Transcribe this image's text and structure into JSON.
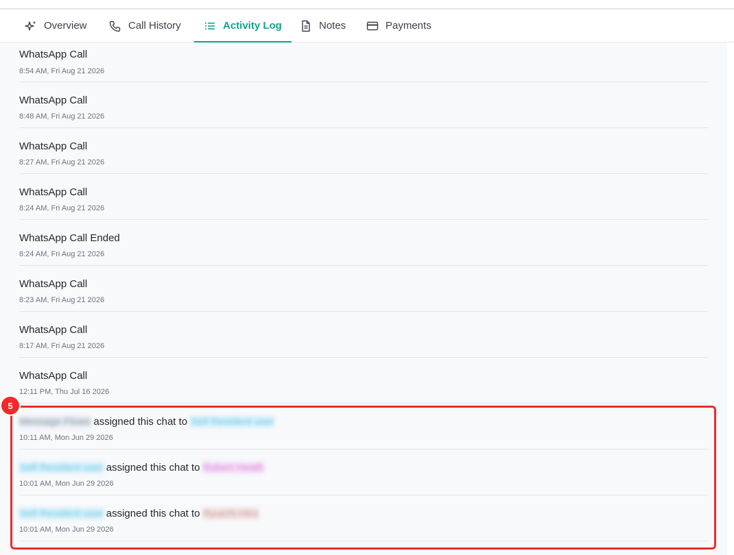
{
  "tabs": [
    {
      "label": "Overview",
      "icon": "sparkle-icon",
      "active": false
    },
    {
      "label": "Call History",
      "icon": "phone-icon",
      "active": false
    },
    {
      "label": "Activity Log",
      "icon": "list-icon",
      "active": true
    },
    {
      "label": "Notes",
      "icon": "document-icon",
      "active": false
    },
    {
      "label": "Payments",
      "icon": "credit-card-icon",
      "active": false
    }
  ],
  "accent_color": "#12a28b",
  "highlight_color": "#ef2a2a",
  "activity": {
    "partial_item": {
      "title": "WhatsApp Call",
      "time": "8:54 AM, Fri Aug 21 2026"
    },
    "items": [
      {
        "title": "WhatsApp Call",
        "time": "8:48 AM, Fri Aug 21 2026"
      },
      {
        "title": "WhatsApp Call",
        "time": "8:27 AM, Fri Aug 21 2026"
      },
      {
        "title": "WhatsApp Call",
        "time": "8:24 AM, Fri Aug 21 2026"
      },
      {
        "title": "WhatsApp Call Ended",
        "time": "8:24 AM, Fri Aug 21 2026"
      },
      {
        "title": "WhatsApp Call",
        "time": "8:23 AM, Fri Aug 21 2026"
      },
      {
        "title": "WhatsApp Call",
        "time": "8:17 AM, Fri Aug 21 2026"
      },
      {
        "title": "WhatsApp Call",
        "time": "12:11 PM, Thu Jul 16 2026"
      }
    ],
    "assignments": [
      {
        "actor": "Message Flows",
        "text": "assigned this chat to",
        "assignee": "Self Resident user",
        "time": "10:11 AM, Mon Jun 29 2026"
      },
      {
        "actor": "Self Resident user",
        "text": "assigned this chat to",
        "assignee": "Robert Heath",
        "time": "10:01 AM, Mon Jun 29 2026"
      },
      {
        "actor": "Self Resident user",
        "text": "assigned this chat to",
        "assignee": "Ryuichi Hiro",
        "time": "10:01 AM, Mon Jun 29 2026"
      }
    ]
  },
  "annotation": {
    "badge": "5"
  }
}
